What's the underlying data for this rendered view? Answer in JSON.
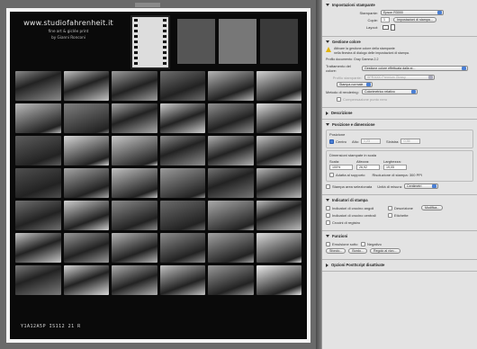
{
  "preview": {
    "label": "",
    "brand": {
      "site": "www.studiofahrenheit.it",
      "line1": "fine art & giclée print",
      "line2": "by Gianni Ronconi"
    },
    "footer_left_1": "Y1A12A5P  IS112 21 R",
    "footer_left_2": "",
    "footer_right": ""
  },
  "thumbs": [
    "#8a8a8a",
    "#c4c4c4",
    "#9d9d9d",
    "#6e6e6e",
    "#b5b5b5",
    "#d2d2d2",
    "#bdbdbd",
    "#7f7f7f",
    "#a9a9a9",
    "#cfcfcf",
    "#919191",
    "#e0e0e0",
    "#5d5d5d",
    "#d6d6d6",
    "#c9c9c9",
    "#8e8e8e",
    "#b2b2b2",
    "#c7c7c7",
    "#4f4f4f",
    "#a6a6a6",
    "#c1c1c1",
    "#9b9b9b",
    "#747474",
    "#b9b9b9",
    "#707070",
    "#d0d0d0",
    "#8b8b8b",
    "#6c6c6c",
    "#aaaaaa",
    "#bebebe",
    "#c9c9c9",
    "#999999",
    "#b7b7b7",
    "#8d8d8d",
    "#a3a3a3",
    "#dadada",
    "#7a7a7a",
    "#d8d8d8",
    "#b0b0b0",
    "#c3c3c3",
    "#9a9a9a",
    "#ececec"
  ],
  "panel": {
    "print_settings": {
      "title": "Impostazioni stampante",
      "printer_label": "Stampante:",
      "printer_value": "Epson R3000",
      "copies_label": "Copie:",
      "copies_value": "1",
      "print_settings_btn": "Impostazioni di stampa...",
      "layout_label": "Layout:"
    },
    "color": {
      "title": "Gestione colore",
      "warn_1": "Attivare la gestione colore della stampante",
      "warn_2": "nella finestra di dialogo delle impostazioni di stampa.",
      "profile_doc": "Profilo documento: Gray Gamma 2.2",
      "handling_label": "Trattamento del colore:",
      "handling_value": "Gestione colore effettuata dalla st...",
      "printer_profile_label": "Profilo stampante:",
      "printer_profile_value": "SPR3000 Premium Glossy",
      "normal_print": "Stampa normale",
      "render_label": "Metodo di rendering:",
      "render_value": "Colorimetrico relativo",
      "black_point": "Compensazione punto nero"
    },
    "description_title": "Descrizione",
    "position": {
      "title": "Posizione e dimensione",
      "position_label": "Posizione",
      "center_label": "Centro",
      "top_label": "Alto:",
      "top_value": "1,23",
      "left_label": "Sinistra:",
      "left_value": "0,35",
      "scaled_label": "Dimensioni stampate in scala",
      "scale_label": "Scala:",
      "scale_value": "100%",
      "height_label": "Altezza:",
      "height_value": "26,92",
      "width_label": "Larghezza:",
      "width_value": "19,05",
      "fit_label": "Adatta al supporto",
      "resolution_label": "Risoluzione di stampa: 300 PPI",
      "selected_area": "Stampa area selezionata",
      "units_label": "Unità di misura:",
      "units_value": "Centimetri"
    },
    "marks": {
      "title": "Indicatori di stampa",
      "corner_marks": "Indicatori di crocino angoli",
      "center_marks": "Indicatori di crocino centrali",
      "description": "Descrizione",
      "labels": "Etichette",
      "registration": "Crocini di registro",
      "edit_btn": "Modifica..."
    },
    "functions": {
      "title": "Funzioni",
      "emulsion_down": "Emulsione sotto",
      "negative": "Negativo",
      "background_btn": "Sfondo...",
      "border_btn": "Bordo...",
      "bleed_btn": "Regolo al vivo..."
    },
    "postscript_title": "Opzioni PostScript disattivate"
  }
}
